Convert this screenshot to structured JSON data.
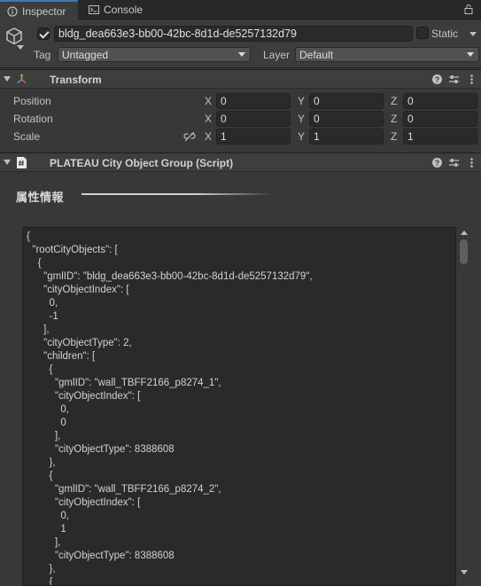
{
  "tabs": {
    "inspector": "Inspector",
    "console": "Console"
  },
  "object": {
    "name": "bldg_dea663e3-bb00-42bc-8d1d-de5257132d79",
    "static_label": "Static",
    "tag_label": "Tag",
    "tag_value": "Untagged",
    "layer_label": "Layer",
    "layer_value": "Default"
  },
  "transform": {
    "title": "Transform",
    "rows": [
      {
        "label": "Position",
        "x": "0",
        "y": "0",
        "z": "0"
      },
      {
        "label": "Rotation",
        "x": "0",
        "y": "0",
        "z": "0"
      },
      {
        "label": "Scale",
        "x": "1",
        "y": "1",
        "z": "1"
      }
    ],
    "axis": {
      "x": "X",
      "y": "Y",
      "z": "Z"
    }
  },
  "script_component": {
    "title": "PLATEAU City Object Group (Script)",
    "section_title": "属性情報",
    "json_lines": [
      "{",
      "  \"rootCityObjects\": [",
      "    {",
      "      \"gmlID\": \"bldg_dea663e3-bb00-42bc-8d1d-de5257132d79\",",
      "      \"cityObjectIndex\": [",
      "        0,",
      "        -1",
      "      ],",
      "      \"cityObjectType\": 2,",
      "      \"children\": [",
      "        {",
      "          \"gmlID\": \"wall_TBFF2166_p8274_1\",",
      "          \"cityObjectIndex\": [",
      "            0,",
      "            0",
      "          ],",
      "          \"cityObjectType\": 8388608",
      "        },",
      "        {",
      "          \"gmlID\": \"wall_TBFF2166_p8274_2\",",
      "          \"cityObjectIndex\": [",
      "            0,",
      "            1",
      "          ],",
      "          \"cityObjectType\": 8388608",
      "        },",
      "        {"
    ]
  },
  "colors": {
    "panel": "#383838",
    "tab_accent": "#3a79bb",
    "field": "#2a2a2a"
  }
}
